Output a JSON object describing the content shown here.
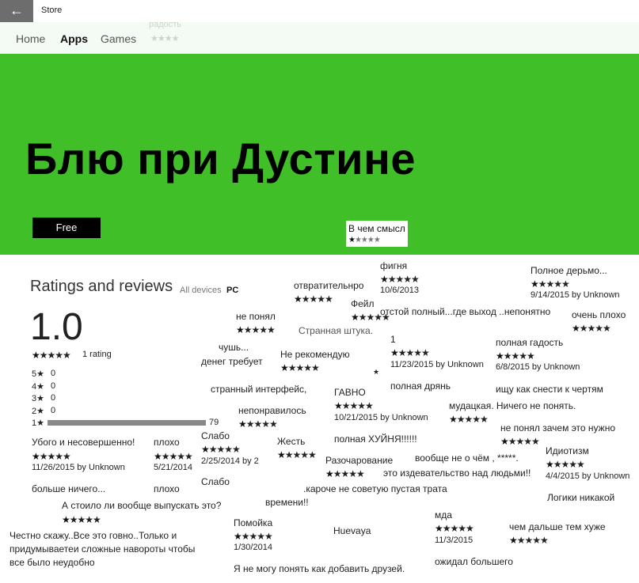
{
  "titlebar": {
    "back_glyph": "←",
    "app_name": "Store"
  },
  "nav": {
    "items": [
      "Home",
      "Apps",
      "Games"
    ],
    "active": "Apps"
  },
  "ghost_text": "радость",
  "hero": {
    "title": "Блю при Дустине",
    "price_button": "Free",
    "card_title": "В чем смысл",
    "card_rating": 1
  },
  "ratings": {
    "heading": "Ratings and reviews",
    "device_all": "All devices",
    "device_pc": "PC",
    "score": "1.0",
    "rating_count": "1 rating",
    "breakdown": [
      {
        "label": "5★",
        "count": "0"
      },
      {
        "label": "4★",
        "count": "0"
      },
      {
        "label": "3★",
        "count": "0"
      },
      {
        "label": "2★",
        "count": "0"
      },
      {
        "label": "1★",
        "count": "79"
      }
    ]
  },
  "reviews": [
    {
      "title": "фигня",
      "stars": 1,
      "meta": "10/6/2013"
    },
    {
      "title": "Полное дерьмо...",
      "stars": 1,
      "meta": "9/14/2015 by Unknown"
    },
    {
      "title": "отвратительнро",
      "stars": 1
    },
    {
      "title": "Фейл",
      "stars": 1
    },
    {
      "title": "отстой полный...где выход ..непонятно"
    },
    {
      "title": "очень плохо",
      "stars": 1
    },
    {
      "title": "не понял",
      "stars": 1
    },
    {
      "title": "Странная штука."
    },
    {
      "title": "чушь..."
    },
    {
      "title": "денег требует"
    },
    {
      "title": "Не рекомендую",
      "stars": 1
    },
    {
      "title": "1",
      "stars": 1,
      "meta": "11/23/2015 by Unknown"
    },
    {
      "title": "полная гадость",
      "stars": 1,
      "meta": "6/8/2015 by Unknown"
    },
    {
      "title": "полная дрянь"
    },
    {
      "title": "странный интерфейс,"
    },
    {
      "title": "ГАВНО",
      "stars": 1,
      "meta": "10/21/2015 by Unknown"
    },
    {
      "title": "ищу как снести к чертям"
    },
    {
      "title": "мудацкая. Ничего не понять.",
      "stars": 1
    },
    {
      "title": "непонравилось",
      "stars": 1
    },
    {
      "title": "не понял зачем это нужно",
      "stars": 1
    },
    {
      "title": "полная ХУЙНЯ!!!!!!"
    },
    {
      "title": "Убого и несовершенно!",
      "stars": 1,
      "meta": "11/26/2015 by Unknown"
    },
    {
      "title": "плохо",
      "stars": 1,
      "meta": "5/21/2014"
    },
    {
      "title": "Слабо",
      "stars": 1,
      "meta": "2/25/2014 by 2"
    },
    {
      "title": "Жесть",
      "stars": 1
    },
    {
      "title": "Идиотизм",
      "stars": 1,
      "meta": "4/4/2015 by Unknown"
    },
    {
      "title": "вообще не о чём , *****."
    },
    {
      "title": "Разочарование",
      "stars": 1
    },
    {
      "title": "это издевательство над людьми!!"
    },
    {
      "title": "больше ничего..."
    },
    {
      "title": "плохо"
    },
    {
      "title": "Слабо"
    },
    {
      "title": ".кароче не советую пустая трата"
    },
    {
      "title": "Логики никакой"
    },
    {
      "title": "А стоило ли вообще выпускать это?",
      "stars": 1
    },
    {
      "title": "времени!!"
    },
    {
      "title": "мда",
      "stars": 1,
      "meta": "11/3/2015"
    },
    {
      "title": "Помойка",
      "stars": 1,
      "meta": "1/30/2014"
    },
    {
      "title": "Huevaya"
    },
    {
      "title": "чем дальше тем хуже",
      "stars": 1
    },
    {
      "title": "Честно скажу..Все это говно..Только и"
    },
    {
      "title": "придумываетеи сложные навороты чтобы"
    },
    {
      "title": "все было неудобно"
    },
    {
      "title": "ожидал большего"
    },
    {
      "title": "Я не могу понять как добавить друзей."
    }
  ]
}
